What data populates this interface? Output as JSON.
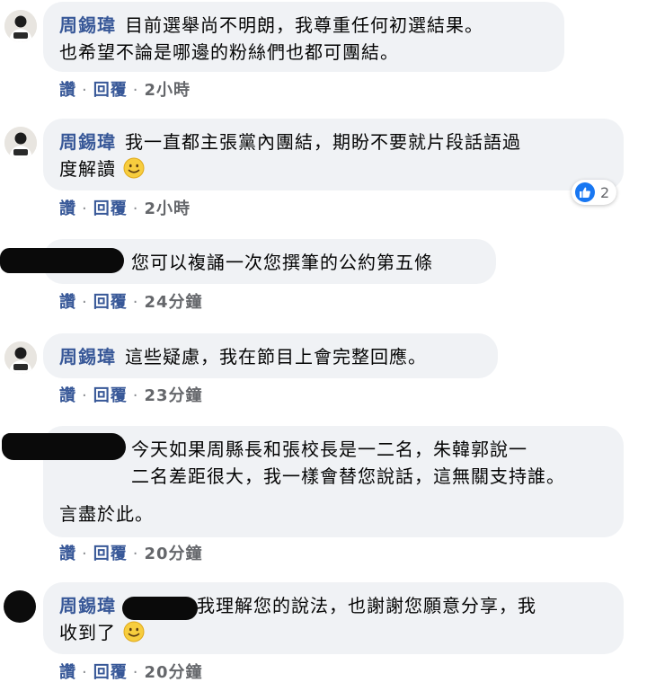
{
  "comments": [
    {
      "author": "周錫瑋",
      "text": "目前選舉尚不明朗，我尊重任何初選結果。\n也希望不論是哪邊的粉絲們也都可團結。",
      "actions": {
        "like": "讚",
        "reply": "回覆",
        "time": "2小時"
      }
    },
    {
      "author": "周錫瑋",
      "text": "我一直都主張黨內團結，期盼不要就片段話語過\n度解讀",
      "emoji": "slightly-smiling-face",
      "reaction_count": "2",
      "actions": {
        "like": "讚",
        "reply": "回覆",
        "time": "2小時"
      }
    },
    {
      "text": "您可以複誦一次您撰筆的公約第五條",
      "actions": {
        "like": "讚",
        "reply": "回覆",
        "time": "24分鐘"
      }
    },
    {
      "author": "周錫瑋",
      "text": "這些疑慮，我在節目上會完整回應。",
      "actions": {
        "like": "讚",
        "reply": "回覆",
        "time": "23分鐘"
      }
    },
    {
      "text": "今天如果周縣長和張校長是一二名，朱韓郭說一\n二名差距很大，我一樣會替您說話，這無關支持誰。",
      "text2": "言盡於此。",
      "actions": {
        "like": "讚",
        "reply": "回覆",
        "time": "20分鐘"
      }
    },
    {
      "author": "周錫瑋",
      "text": "我理解您的說法，也謝謝您願意分享，我\n收到了",
      "emoji": "slightly-smiling-face",
      "actions": {
        "like": "讚",
        "reply": "回覆",
        "time": "20分鐘"
      }
    }
  ],
  "colors": {
    "name": "#385898",
    "bubble": "#f0f2f5",
    "like_blue": "#1877f2"
  }
}
